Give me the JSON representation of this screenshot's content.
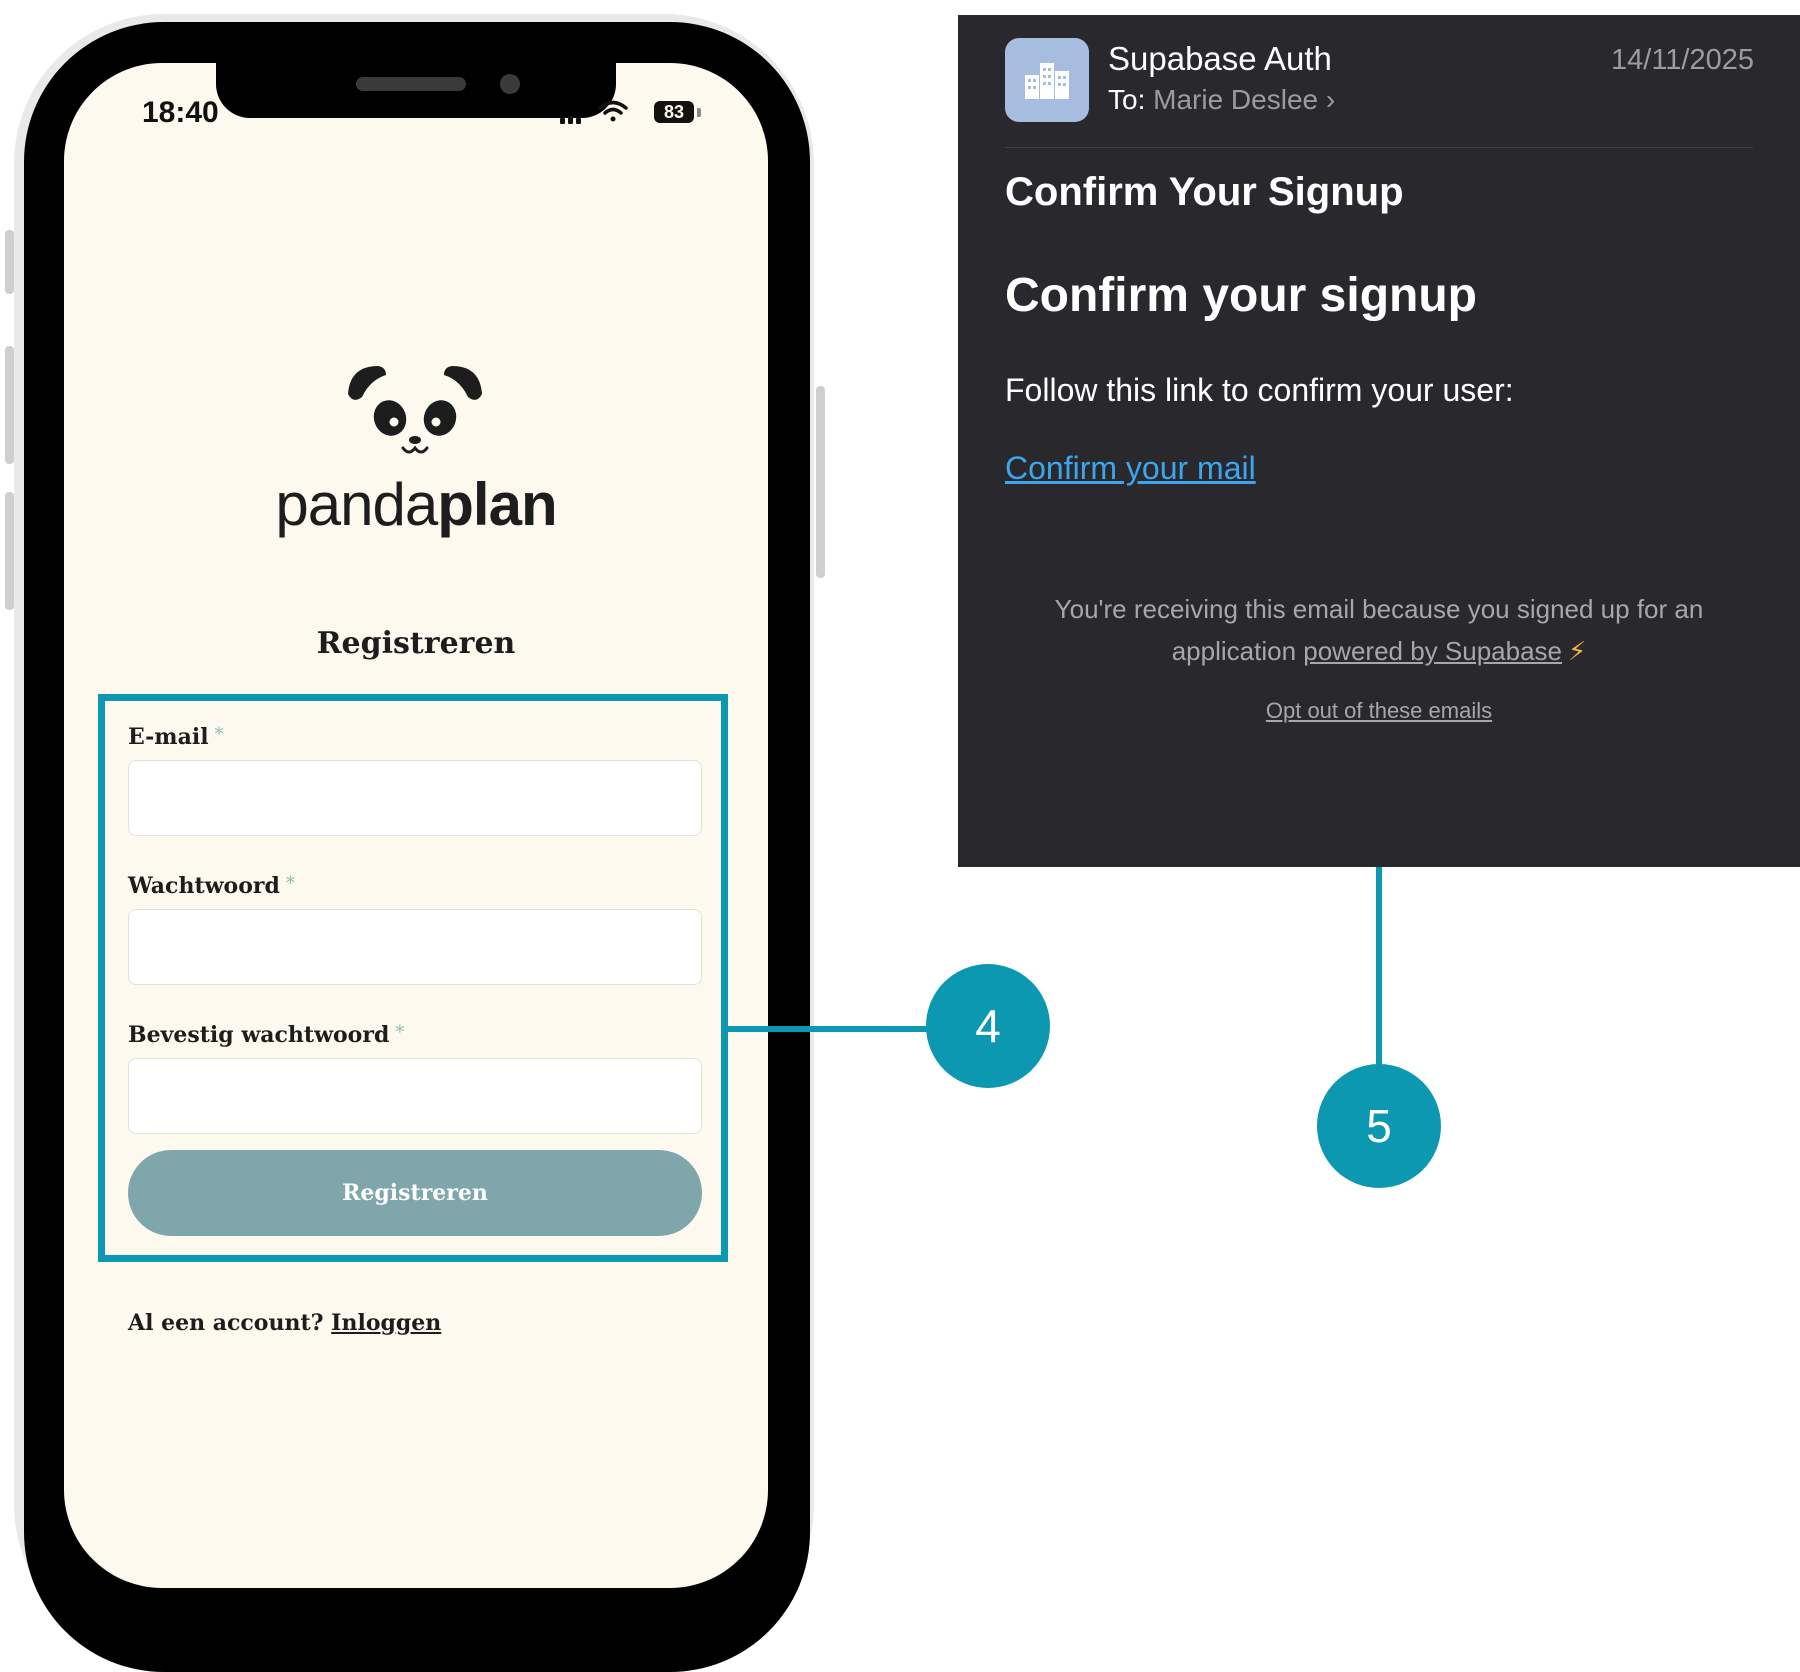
{
  "phone": {
    "status": {
      "time": "18:40",
      "battery": "83"
    },
    "brand": {
      "light": "panda",
      "bold": "plan"
    },
    "form": {
      "title": "Registreren",
      "fields": [
        {
          "label": "E-mail",
          "required_mark": "*",
          "value": "",
          "placeholder": ""
        },
        {
          "label": "Wachtwoord",
          "required_mark": "*",
          "value": "",
          "placeholder": ""
        },
        {
          "label": "Bevestig wachtwoord",
          "required_mark": "*",
          "value": "",
          "placeholder": ""
        }
      ],
      "submit_label": "Registreren"
    },
    "login_prompt": {
      "text": "Al een account?",
      "link": "Inloggen"
    }
  },
  "callouts": {
    "step_a": "4",
    "step_b": "5"
  },
  "email": {
    "sender": "Supabase Auth",
    "to_label": "To:",
    "recipient": "Marie Deslee",
    "date": "14/11/2025",
    "subject": "Confirm Your Signup",
    "heading": "Confirm your signup",
    "body": "Follow this link to confirm your user:",
    "link_text": "Confirm your mail",
    "footer_prefix": "You're receiving this email because you signed up for an application",
    "footer_link": "powered by Supabase",
    "opt_out": "Opt out of these emails"
  },
  "colors": {
    "accent": "#0d98b2",
    "phone_screen": "#fdf9ee",
    "button": "#7fa6aa",
    "email_bg": "#29292d",
    "email_link": "#3ba6ee"
  },
  "icons": [
    "wifi-icon",
    "cellular-signal-icon",
    "battery-icon",
    "panda-logo-icon",
    "building-icon",
    "chevron-right-icon",
    "lightning-bolt-icon"
  ]
}
